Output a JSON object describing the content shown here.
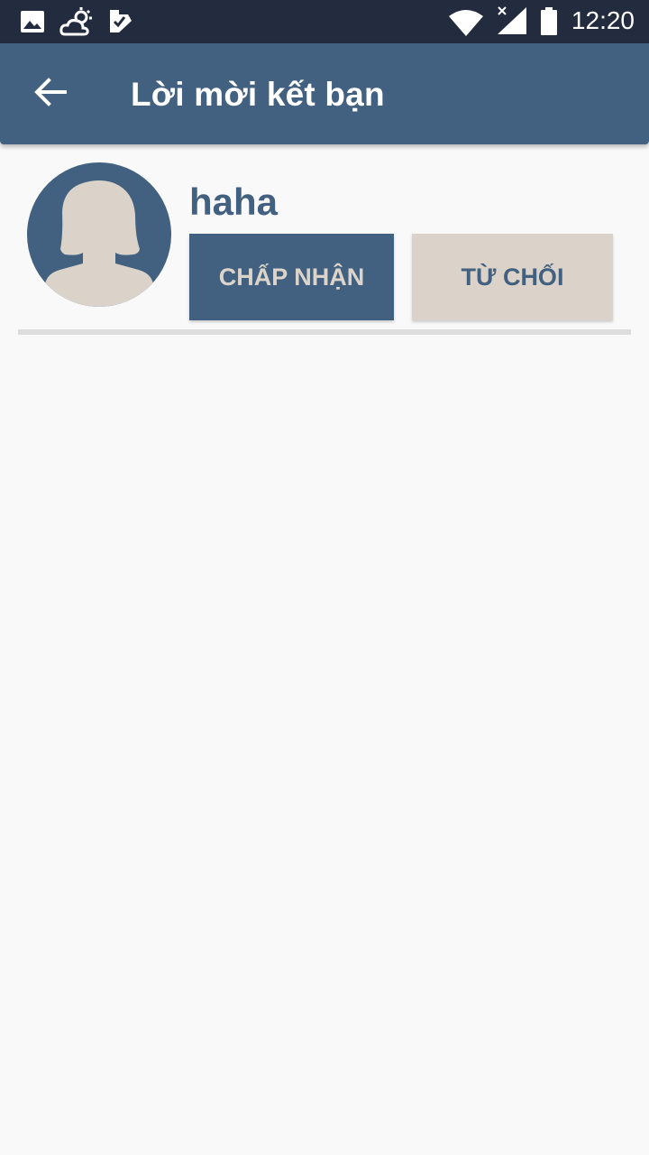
{
  "status_bar": {
    "time": "12:20",
    "icons": [
      "image-icon",
      "weather-icon",
      "task-check-icon",
      "wifi-icon",
      "signal-icon",
      "battery-icon"
    ]
  },
  "app_bar": {
    "title": "Lời mời kết bạn",
    "back_icon": "arrow-left-icon",
    "background_color": "#42607f"
  },
  "friend_requests": [
    {
      "name": "haha",
      "accept_label": "CHẤP NHẬN",
      "reject_label": "TỪ CHỐI"
    }
  ],
  "colors": {
    "primary": "#42607f",
    "secondary": "#dbd3c9",
    "status_bar": "#232b3f",
    "background": "#f9f9f9"
  }
}
